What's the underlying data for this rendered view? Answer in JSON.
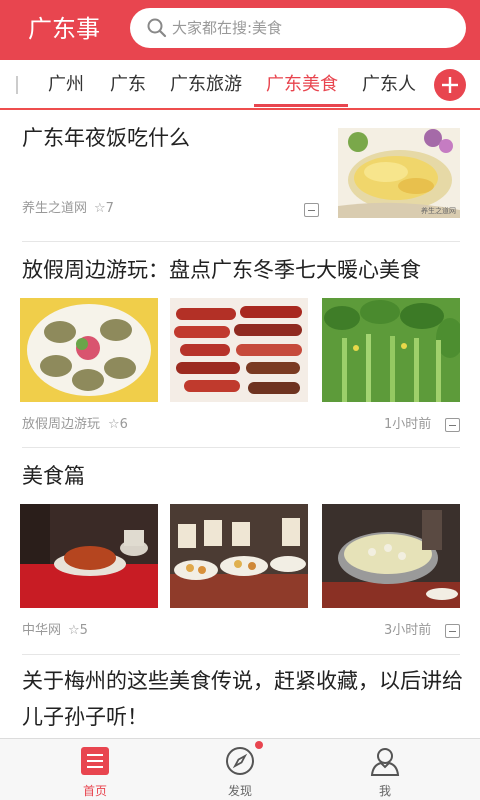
{
  "header": {
    "app_title": "广东事",
    "search_placeholder": "大家都在搜:美食"
  },
  "tabs": [
    {
      "label": "广州",
      "active": false
    },
    {
      "label": "广东",
      "active": false
    },
    {
      "label": "广东旅游",
      "active": false
    },
    {
      "label": "广东美食",
      "active": true
    },
    {
      "label": "广东人",
      "active": false
    }
  ],
  "articles": [
    {
      "title": "广东年夜饭吃什么",
      "source": "养生之道网",
      "stars": "☆7",
      "time": "",
      "image_watermark": "养生之道网"
    },
    {
      "title": "放假周边游玩：盘点广东冬季七大暖心美食",
      "source": "放假周边游玩",
      "stars": "☆6",
      "time": "1小时前"
    },
    {
      "title": "美食篇",
      "source": "中华网",
      "stars": "☆5",
      "time": "3小时前"
    },
    {
      "title_line1": "关于梅州的这些美食传说，赶紧收藏，以后讲给",
      "title_line2": "儿子孙子听！"
    }
  ],
  "bottom_nav": [
    {
      "label": "首页",
      "icon": "home-list-icon",
      "active": true
    },
    {
      "label": "发现",
      "icon": "compass-icon",
      "active": false,
      "notification": true
    },
    {
      "label": "我",
      "icon": "user-icon",
      "active": false
    }
  ],
  "colors": {
    "accent": "#e8454f",
    "text": "#222222",
    "meta": "#999999"
  }
}
